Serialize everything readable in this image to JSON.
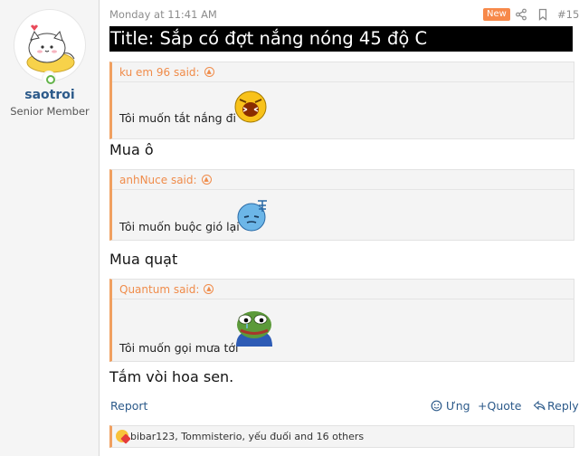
{
  "user": {
    "name": "saotroi",
    "title": "Senior Member"
  },
  "post": {
    "date": "Monday at 11:41 AM",
    "badge": "New",
    "number": "#15",
    "title": "Title: Sắp có đợt nắng nóng 45 độ C"
  },
  "quotes": [
    {
      "author": "ku em 96 said:",
      "text": "Tôi muốn tắt nắng đi",
      "reply": "Mua ô"
    },
    {
      "author": "anhNuce said:",
      "text": "Tôi muốn buộc gió lại",
      "reply": "Mua quạt"
    },
    {
      "author": "Quantum said:",
      "text": "Tôi muốn gọi mưa tới",
      "reply": "Tắm vòi hoa sen."
    }
  ],
  "actions": {
    "report": "Report",
    "ung": "Ưng",
    "quote": "+Quote",
    "reply": "Reply"
  },
  "reactions": {
    "text": "bibar123, Tommisterio, yếu đuối and 16 others"
  },
  "colors": {
    "accent": "#f08c4a",
    "link": "#2c5a8a",
    "badge": "#f7894a"
  }
}
